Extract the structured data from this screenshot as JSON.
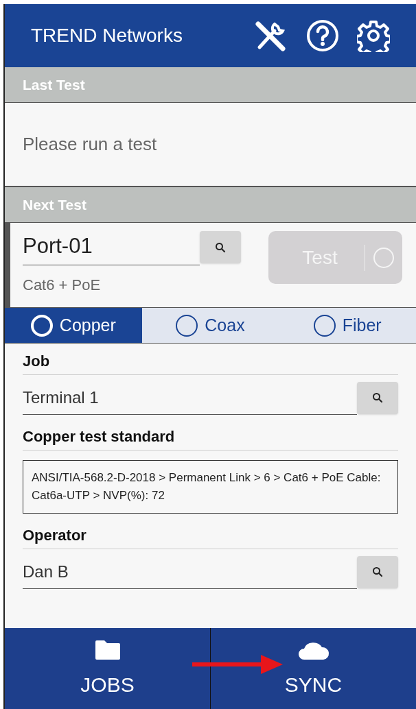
{
  "header": {
    "title": "TREND Networks"
  },
  "last_test": {
    "heading": "Last Test",
    "message": "Please run a test"
  },
  "next_test": {
    "heading": "Next Test",
    "port": "Port-01",
    "cable": "Cat6 + PoE",
    "test_button": {
      "label": "Test",
      "disabled": true
    }
  },
  "media_tabs": [
    {
      "label": "Copper",
      "selected": true
    },
    {
      "label": "Coax",
      "selected": false
    },
    {
      "label": "Fiber",
      "selected": false
    }
  ],
  "form": [
    {
      "kind": "lookup",
      "label": "Job",
      "value": "Terminal 1"
    },
    {
      "kind": "text",
      "label": "Copper test standard",
      "value": "ANSI/TIA-568.2-D-2018 > Permanent Link > 6 > Cat6 + PoE Cable: Cat6a-UTP > NVP(%): 72"
    },
    {
      "kind": "lookup",
      "label": "Operator",
      "value": "Dan B"
    }
  ],
  "bottom_nav": [
    {
      "kind": "folder",
      "label": "JOBS"
    },
    {
      "kind": "cloud",
      "label": "SYNC"
    }
  ]
}
